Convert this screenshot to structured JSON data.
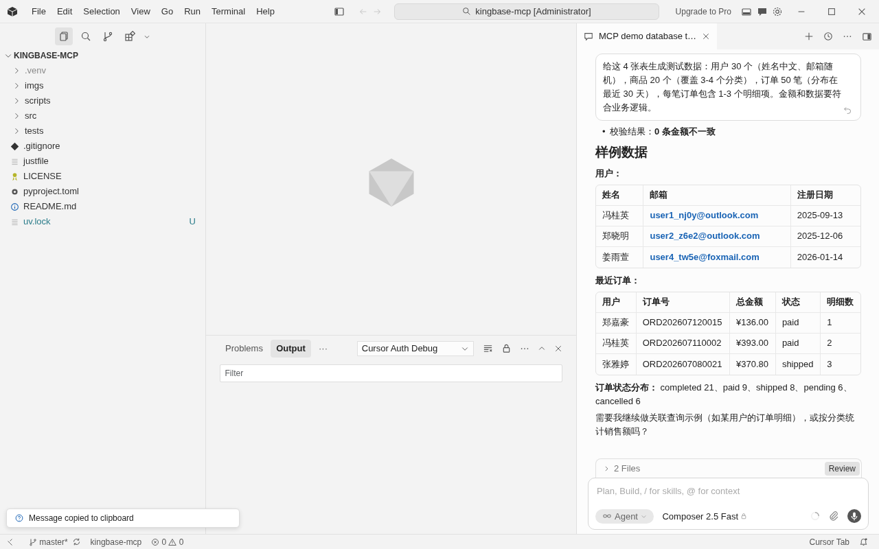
{
  "menu": [
    "File",
    "Edit",
    "Selection",
    "View",
    "Go",
    "Run",
    "Terminal",
    "Help"
  ],
  "command_center": {
    "text": "kingbase-mcp [Administrator]"
  },
  "upgrade_link": "Upgrade to Pro",
  "activity_tabs": [
    {
      "kind": "files",
      "selected": true
    },
    {
      "kind": "search",
      "selected": false
    },
    {
      "kind": "source-control",
      "selected": false
    },
    {
      "kind": "extensions",
      "selected": false
    }
  ],
  "explorer": {
    "root": {
      "label": "KINGBASE-MCP",
      "expanded": true
    },
    "items": [
      {
        "label": ".venv",
        "kind": "folder",
        "expanded": false,
        "dimmed": true
      },
      {
        "label": "imgs",
        "kind": "folder",
        "expanded": false,
        "dimmed": false
      },
      {
        "label": "scripts",
        "kind": "folder",
        "expanded": false,
        "dimmed": false
      },
      {
        "label": "src",
        "kind": "folder",
        "expanded": false,
        "dimmed": false
      },
      {
        "label": "tests",
        "kind": "folder",
        "expanded": false,
        "dimmed": false
      },
      {
        "label": ".gitignore",
        "kind": "git",
        "dimmed": false
      },
      {
        "label": "justfile",
        "kind": "text",
        "dimmed": false
      },
      {
        "label": "LICENSE",
        "kind": "license",
        "dimmed": false
      },
      {
        "label": "pyproject.toml",
        "kind": "settings",
        "dimmed": false
      },
      {
        "label": "README.md",
        "kind": "info",
        "dimmed": false
      },
      {
        "label": "uv.lock",
        "kind": "text",
        "dimmed": false,
        "git_status": "U"
      }
    ]
  },
  "panel": {
    "tabs": [
      {
        "label": "Problems",
        "selected": false
      },
      {
        "label": "Output",
        "selected": true
      }
    ],
    "more": "···",
    "channel": "Cursor Auth Debug",
    "filter": {
      "placeholder": "Filter"
    }
  },
  "chat": {
    "tab_title": "MCP demo database t…",
    "prompt": "给这 4 张表生成测试数据：用户 30 个（姓名中文、邮箱随机），商品 20 个（覆盖 3-4 个分类），订单 50 笔（分布在最近 30 天），每笔订单包含 1-3 个明细项。金额和数据要符合业务逻辑。",
    "bullets": [
      {
        "marker": "•",
        "text": "校验结果：**0 条金额不一致**"
      }
    ],
    "heading": "样例数据",
    "users_label": "用户：",
    "users_table": {
      "columns": [
        "姓名",
        "邮箱",
        "注册日期"
      ],
      "rows": [
        [
          "冯桂英",
          "user1_nj0y@outlook.com",
          "2025-09-13"
        ],
        [
          "郑晓明",
          "user2_z6e2@outlook.com",
          "2025-12-06"
        ],
        [
          "姜雨萱",
          "user4_tw5e@foxmail.com",
          "2026-01-14"
        ]
      ]
    },
    "orders_label": "最近订单：",
    "orders_table": {
      "columns": [
        "用户",
        "订单号",
        "总金额",
        "状态",
        "明细数"
      ],
      "rows": [
        [
          "郑嘉豪",
          "ORD202607120015",
          "¥136.00",
          "paid",
          "1"
        ],
        [
          "冯桂英",
          "ORD202607110002",
          "¥393.00",
          "paid",
          "2"
        ],
        [
          "张雅婷",
          "ORD202607080021",
          "¥370.80",
          "shipped",
          "3"
        ]
      ]
    },
    "status_summary": "**订单状态分布：** completed 21、paid 9、shipped 8、pending 6、cancelled 6",
    "question": "需要我继续做关联查询示例（如某用户的订单明细），或按分类统计销售额吗？",
    "files_bar": {
      "label": "2 Files",
      "button": "Review"
    },
    "composer": {
      "placeholder": "Plan, Build, / for skills, @ for context",
      "mode": "Agent",
      "model": "Composer 2.5 Fast"
    }
  },
  "toast": "Message copied to clipboard",
  "status_bar": {
    "branch": "master*",
    "project": "kingbase-mcp",
    "errors": "0",
    "warnings": "0",
    "right": "Cursor Tab"
  }
}
